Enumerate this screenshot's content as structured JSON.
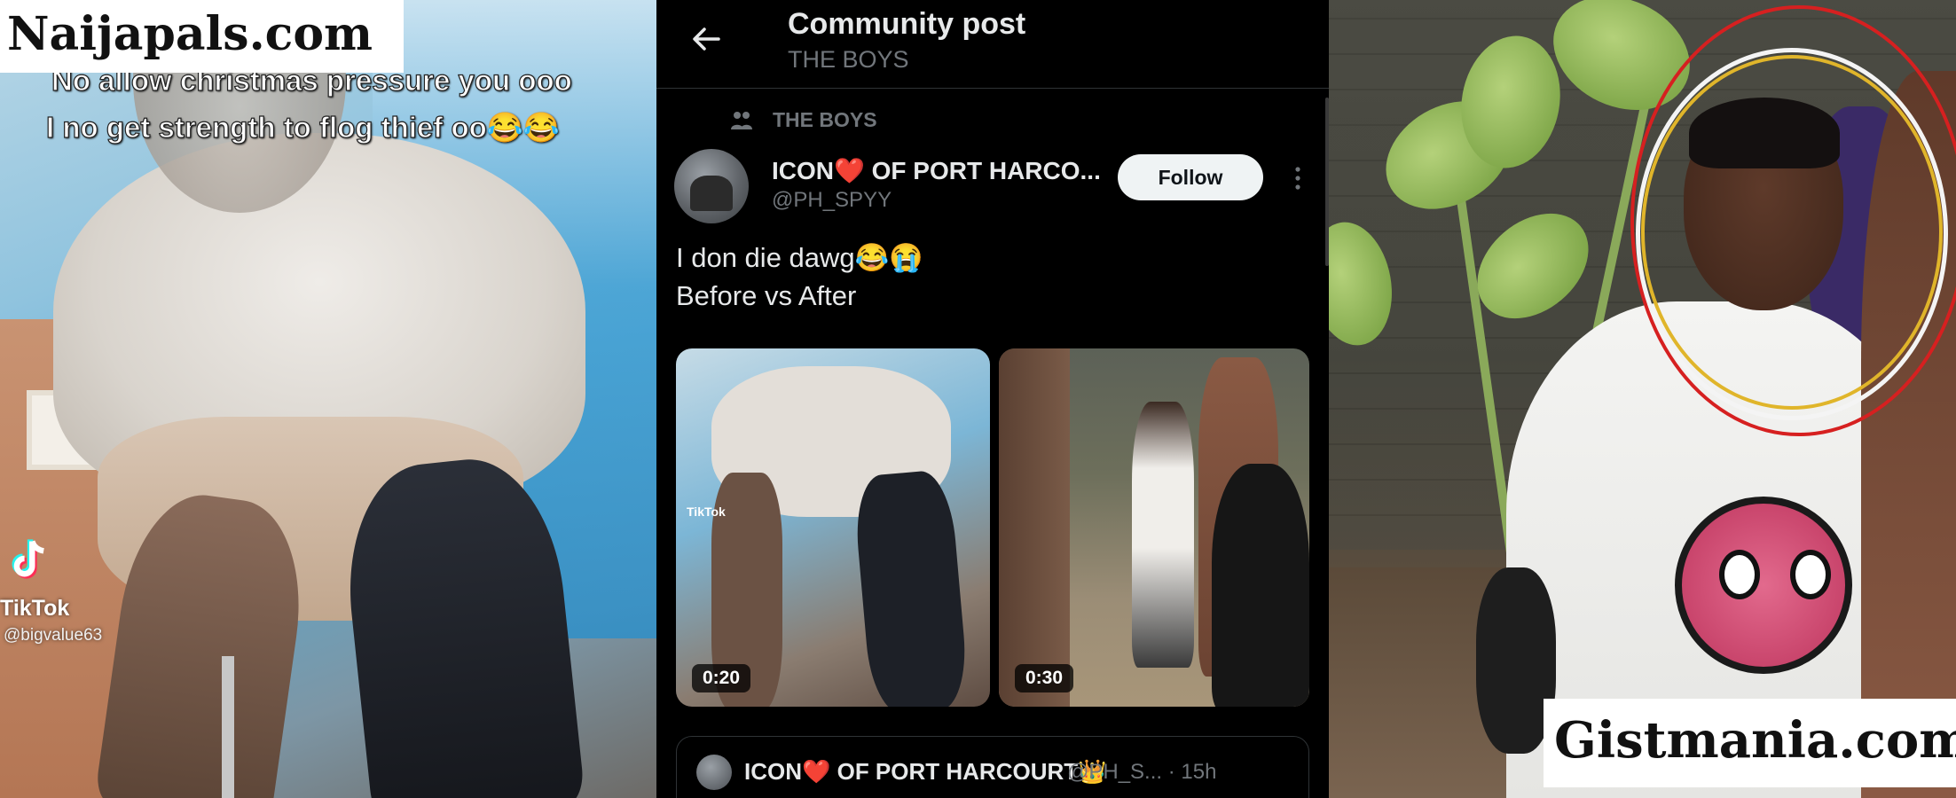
{
  "left_frame": {
    "watermark": "Naijapals.com",
    "caption_line1": "No allow christmas pressure you ooo",
    "caption_line2": "I no get strength to flog thief oo😂😂",
    "tiktok_label": "TikTok",
    "tiktok_handle": "@bigvalue63",
    "icon": "tiktok-icon"
  },
  "twitter_screen": {
    "header": {
      "title": "Community post",
      "subtitle": "THE BOYS",
      "back_icon": "arrow-left-icon"
    },
    "community_label": "THE BOYS",
    "post": {
      "author_name": "ICON❤️ OF PORT HARCO...",
      "author_handle": "@PH_SPYY",
      "follow_label": "Follow",
      "text_line1": "I don die dawg😂😭",
      "text_line2": "Before vs After",
      "media": [
        {
          "duration": "0:20",
          "watermark": "TikTok"
        },
        {
          "duration": "0:30"
        }
      ]
    },
    "quoted": {
      "author_name": "ICON❤️ OF PORT HARCOURT👑",
      "handle_time": "@PH_S... · 15h"
    },
    "colors": {
      "background": "#000000",
      "text": "#e7e9ea",
      "muted": "#71767b",
      "follow_bg": "#eff3f4"
    }
  },
  "right_frame": {
    "watermark": "Gistmania.com",
    "highlight_colors": [
      "#d62020",
      "#f4f4f4",
      "#e0b52a"
    ]
  }
}
